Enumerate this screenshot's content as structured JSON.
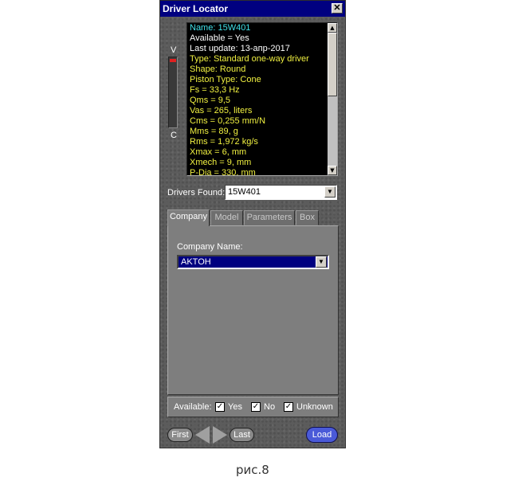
{
  "window": {
    "title": "Driver Locator",
    "close_glyph": "✕"
  },
  "meter": {
    "top_label": "V",
    "bottom_label": "C",
    "level_color": "#e02020"
  },
  "info": {
    "lines": [
      {
        "text": "Name: 15W401",
        "color": "#40e0e8"
      },
      {
        "text": "Available = Yes",
        "color": "#ffffff"
      },
      {
        "text": "Last update: 13-апр-2017",
        "color": "#ffffff"
      },
      {
        "text": "Type: Standard one-way driver",
        "color": "#f0f040"
      },
      {
        "text": "Shape: Round",
        "color": "#f0f040"
      },
      {
        "text": "Piston Type: Cone",
        "color": "#f0f040"
      },
      {
        "text": "Fs =  33,3 Hz",
        "color": "#f0f040"
      },
      {
        "text": "Qms =  9,5",
        "color": "#f0f040"
      },
      {
        "text": "Vas =  265, liters",
        "color": "#f0f040"
      },
      {
        "text": "Cms =  0,255 mm/N",
        "color": "#f0f040"
      },
      {
        "text": "Mms =  89, g",
        "color": "#f0f040"
      },
      {
        "text": "Rms =  1,972 kg/s",
        "color": "#f0f040"
      },
      {
        "text": "Xmax =  6, mm",
        "color": "#f0f040"
      },
      {
        "text": "Xmech =  9, mm",
        "color": "#f0f040"
      },
      {
        "text": "P-Dia =  330, mm",
        "color": "#f0f040"
      }
    ]
  },
  "drivers_found": {
    "label": "Drivers Found:",
    "value": "15W401"
  },
  "tabs": [
    {
      "label": "Company",
      "active": true
    },
    {
      "label": "Model",
      "active": false
    },
    {
      "label": "Parameters",
      "active": false
    },
    {
      "label": "Box",
      "active": false
    }
  ],
  "company": {
    "label": "Company Name:",
    "value": "AKTOH"
  },
  "available": {
    "label": "Available:",
    "options": [
      {
        "label": "Yes",
        "checked": true
      },
      {
        "label": "No",
        "checked": true
      },
      {
        "label": "Unknown",
        "checked": true
      }
    ]
  },
  "nav": {
    "first_label": "First",
    "last_label": "Last",
    "load_label": "Load"
  },
  "caption": "рис.8"
}
